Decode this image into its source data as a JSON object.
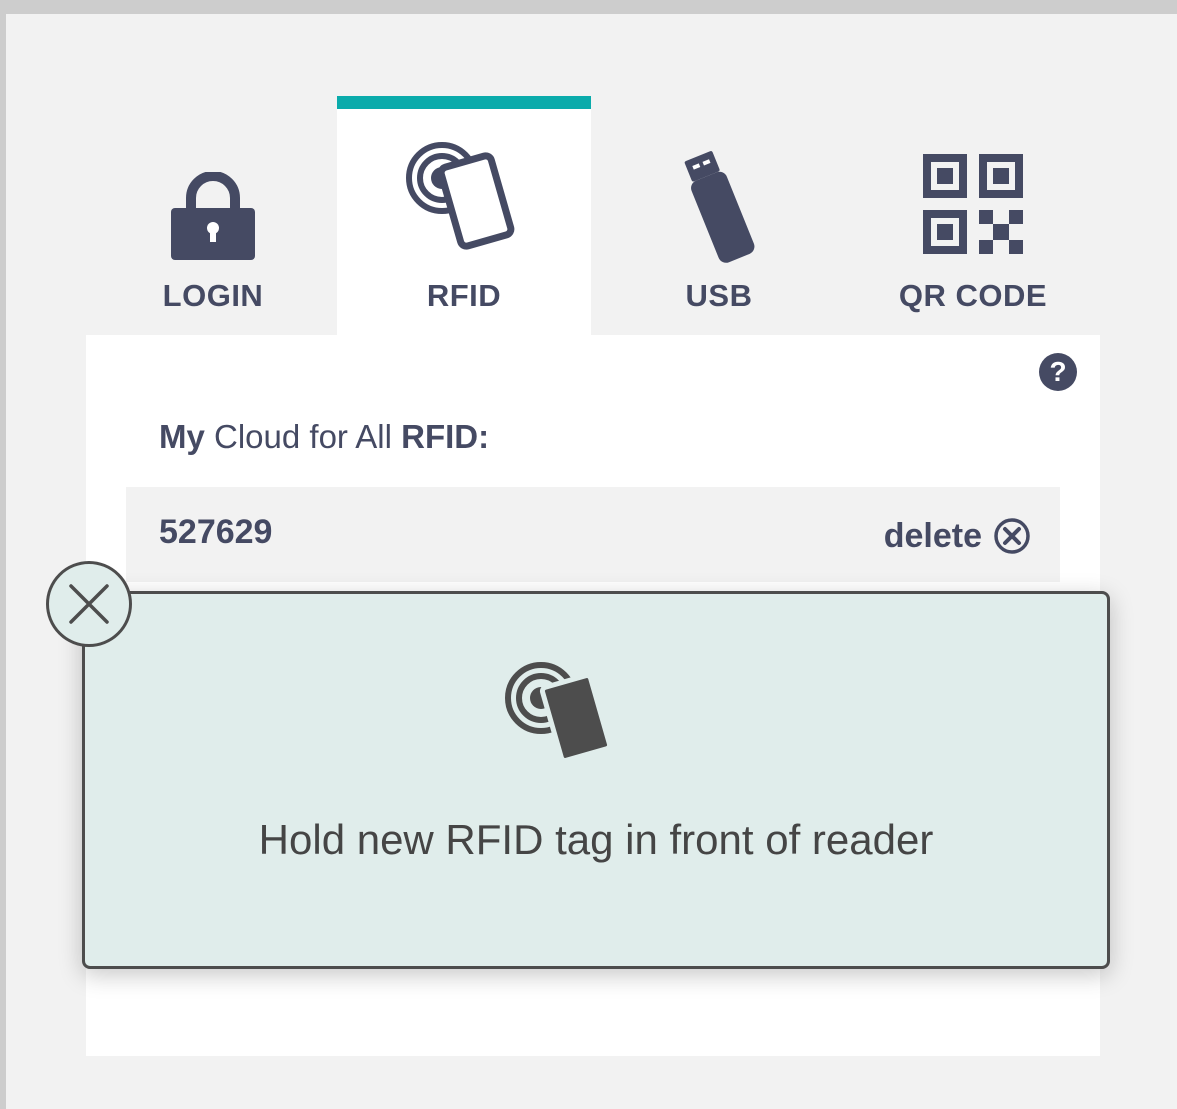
{
  "tabs": [
    {
      "label": "LOGIN",
      "icon": "lock-icon"
    },
    {
      "label": "RFID",
      "icon": "rfid-card-icon",
      "active": true
    },
    {
      "label": "USB",
      "icon": "usb-stick-icon"
    },
    {
      "label": "QR CODE",
      "icon": "qr-code-icon"
    }
  ],
  "help": {
    "symbol": "?"
  },
  "section": {
    "heading_bold_1": "My",
    "heading_regular": "Cloud for All",
    "heading_bold_2": "RFID:"
  },
  "rfid_entry": {
    "number": "527629",
    "delete_label": "delete"
  },
  "dialog": {
    "message": "Hold new RFID tag in front of reader",
    "icon": "rfid-card-icon",
    "close_icon": "close-icon"
  },
  "colors": {
    "accent": "#0aabab",
    "text": "#454a63",
    "dialog_bg": "#e0edeb",
    "page_bg": "#f2f2f2"
  }
}
